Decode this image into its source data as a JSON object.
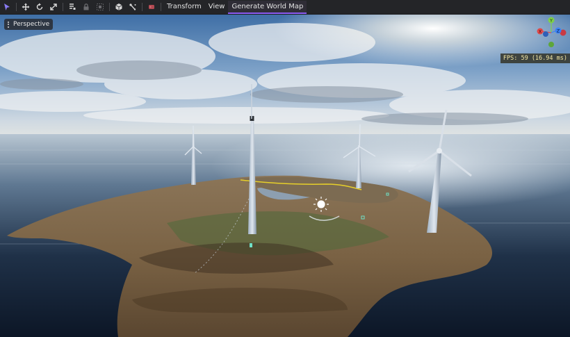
{
  "toolbar": {
    "tools": [
      {
        "name": "select-tool",
        "icon": "select-arrow-icon"
      },
      {
        "name": "move-tool",
        "icon": "move-icon"
      },
      {
        "name": "rotate-tool",
        "icon": "rotate-icon"
      },
      {
        "name": "scale-tool",
        "icon": "scale-icon"
      },
      {
        "name": "list-tool",
        "icon": "list-icon"
      },
      {
        "name": "lock-tool",
        "icon": "lock-icon"
      },
      {
        "name": "group-tool",
        "icon": "group-icon"
      },
      {
        "name": "object-tool",
        "icon": "cube-icon"
      },
      {
        "name": "bone-tool",
        "icon": "bone-icon"
      },
      {
        "name": "record-tool",
        "icon": "record-icon"
      }
    ],
    "menus": [
      "Transform",
      "View",
      "Generate World Map"
    ],
    "active_menu": "Generate World Map"
  },
  "viewport": {
    "camera_label": "Perspective",
    "fps_text": "FPS: 59 (16.94 ms)",
    "gizmo_axes": {
      "x": "X",
      "y": "Y",
      "z": "Z"
    }
  },
  "colors": {
    "accent": "#8b5cf6",
    "axis_x": "#e04a4a",
    "axis_y": "#7ed04a",
    "axis_z": "#3b82f6"
  }
}
